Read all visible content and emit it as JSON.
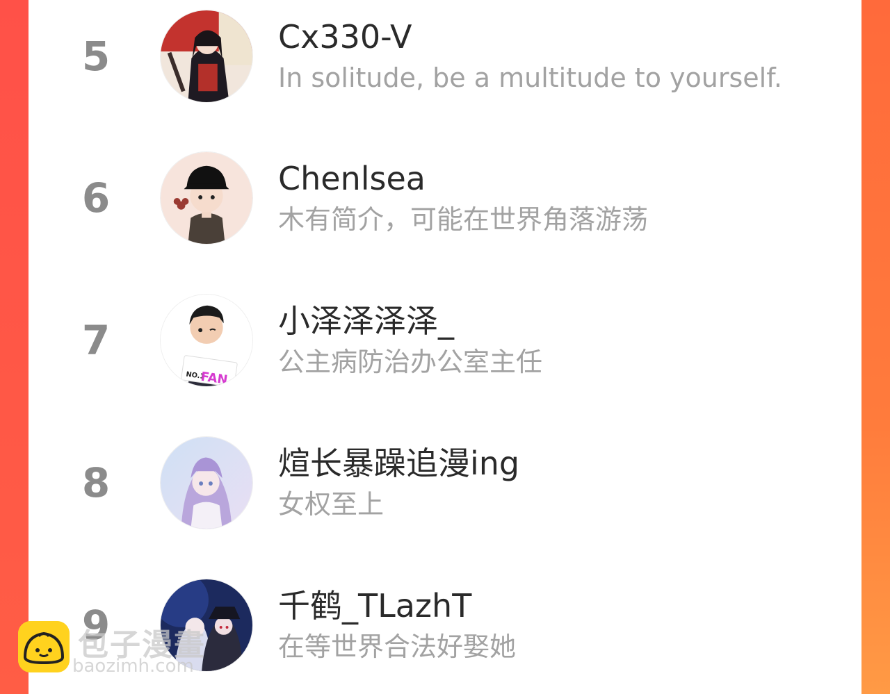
{
  "leaderboard": {
    "entries": [
      {
        "rank": "5",
        "name": "Cx330-V",
        "bio": "In solitude, be a multitude to yourself."
      },
      {
        "rank": "6",
        "name": "Chenlsea",
        "bio": "木有简介，可能在世界角落游荡"
      },
      {
        "rank": "7",
        "name": "小泽泽泽泽_",
        "bio": "公主病防治办公室主任",
        "avatar_text": {
          "badge": "NO.1",
          "word": "FAN"
        }
      },
      {
        "rank": "8",
        "name": "煊长暴躁追漫ing",
        "bio": "女权至上"
      },
      {
        "rank": "9",
        "name": "千鹤_TLazhT",
        "bio": "在等世界合法好娶她"
      }
    ]
  },
  "watermark": {
    "title": "包子漫畫",
    "url": "baozimh.com",
    "logo_icon": "bun-face-icon"
  },
  "colors": {
    "accent": "#ff5a4a",
    "rank_text": "#8b8b8b",
    "name_text": "#2a2a2a",
    "bio_text": "#a2a2a2",
    "logo_bg": "#ffd21e"
  }
}
